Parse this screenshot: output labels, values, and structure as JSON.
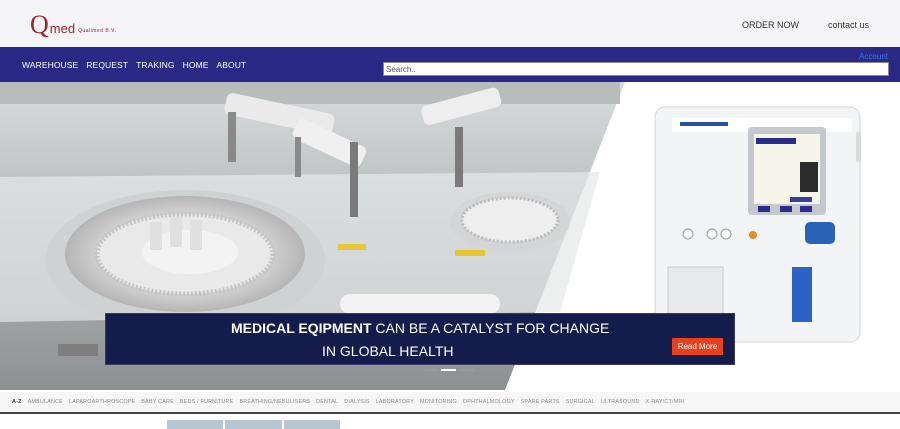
{
  "brand": {
    "q": "Q",
    "med": "med",
    "sub": "Qualimed B.V."
  },
  "top_links": [
    "ORDER NOW",
    "contact us"
  ],
  "nav": [
    "WAREHOUSE",
    "REQUEST",
    "TRAKING",
    "HOME",
    "ABOUT"
  ],
  "account": "Account",
  "search": {
    "placeholder": "Search..",
    "value": ""
  },
  "hero": {
    "caption_strong": "MEDICAL EQIPMENT",
    "caption_rest": " CAN BE A CATALYST FOR CHANGE",
    "caption_line2": "IN GLOBAL HEALTH",
    "read_more": "Read More",
    "arrow": "‹",
    "slides_count": 3,
    "active_slide": 2
  },
  "categories": [
    "A-Z",
    "AMBULANCE",
    "LAPAROARTHROSCOPE",
    "BABY CARE",
    "BEDS / FURNITURE",
    "BREATHING/NEBULISERS",
    "DENTAL",
    "DIALYSIS",
    "LABORATORY",
    "MONITORING",
    "OPHTHALMOLOGY",
    "SPARE PARTS",
    "SURGICAL",
    "ULTRASOUND",
    "X-RAY/CT/MRI"
  ],
  "colors": {
    "navbar": "#2a2a86",
    "brand": "#a0242b",
    "cta": "#e8401c",
    "caption_bg": "#141c4c"
  }
}
